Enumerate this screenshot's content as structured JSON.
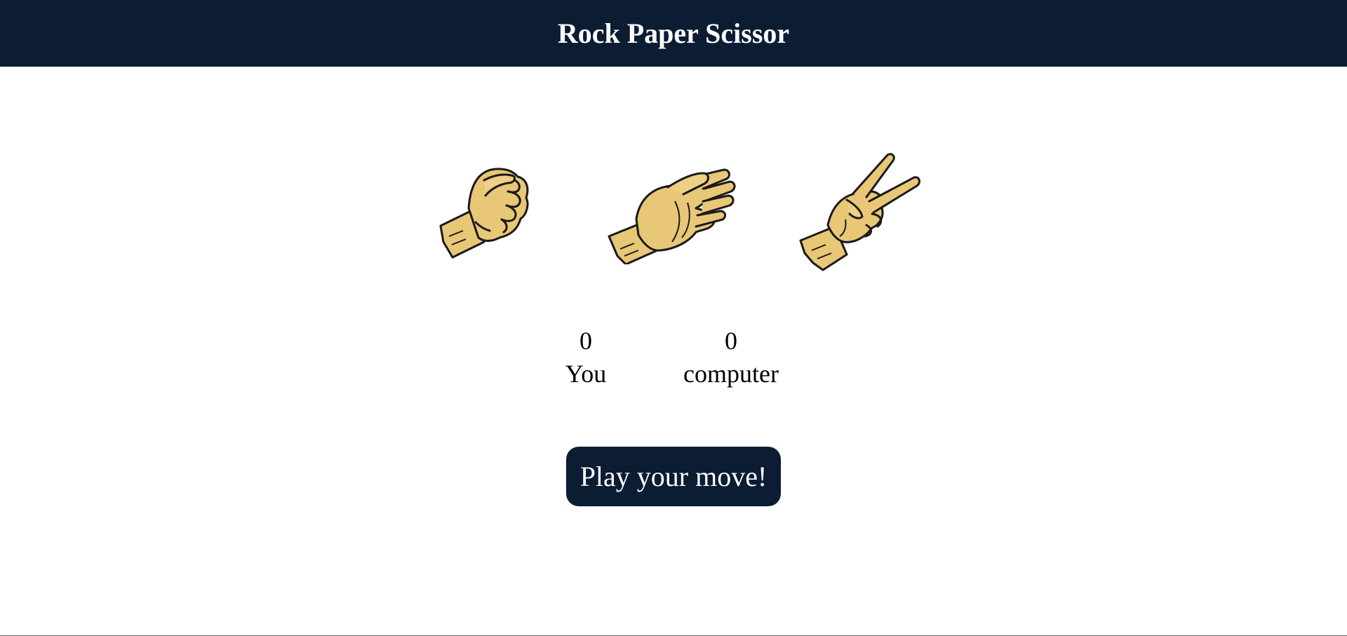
{
  "header": {
    "title": "Rock Paper Scissor"
  },
  "choices": [
    {
      "id": "rock",
      "icon": "rock-fist-icon"
    },
    {
      "id": "paper",
      "icon": "paper-hand-icon"
    },
    {
      "id": "scissor",
      "icon": "scissor-hand-icon"
    }
  ],
  "scoreboard": {
    "you": {
      "score": "0",
      "label": "You"
    },
    "computer": {
      "score": "0",
      "label": "computer"
    }
  },
  "play_button": {
    "label": "Play your move!"
  },
  "colors": {
    "header_bg": "#0b1c33",
    "hand_fill": "#e8c776",
    "hand_outline": "#1a1a1a"
  }
}
